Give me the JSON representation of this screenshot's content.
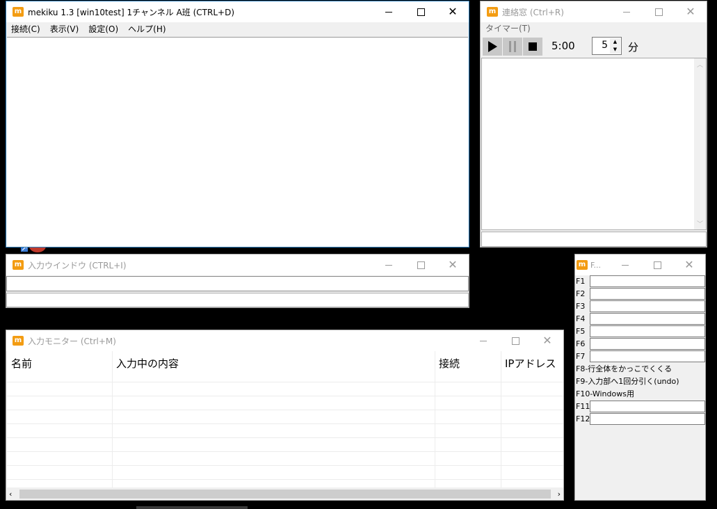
{
  "main_window": {
    "title": "mekiku 1.3 [win10test] 1チャンネル A班 (CTRL+D)",
    "menu": [
      "接続(C)",
      "表示(V)",
      "設定(O)",
      "ヘルプ(H)"
    ]
  },
  "contact_window": {
    "title": "連絡窓 (Ctrl+R)",
    "menu": [
      "タイマー(T)"
    ],
    "timer_display": "5:00",
    "minutes_value": "5",
    "minutes_unit": "分"
  },
  "input_window": {
    "title": "入力ウインドウ (CTRL+I)"
  },
  "monitor_window": {
    "title": "入力モニター (Ctrl+M)",
    "columns": [
      "名前",
      "入力中の内容",
      "接続",
      "IPアドレス"
    ]
  },
  "fkey_window": {
    "title": "F...",
    "keys_top": [
      "F1",
      "F2",
      "F3",
      "F4",
      "F5",
      "F6",
      "F7"
    ],
    "notes": [
      "F8-行全体をかっこでくくる",
      "F9-入力部へ1回分引く(undo)",
      "F10-Windows用"
    ],
    "keys_bottom": [
      "F11",
      "F12"
    ]
  },
  "colors": {
    "app_icon": "#f39c12",
    "active_border": "#2b7bb9"
  },
  "icons": {
    "app": "mekiku-app-icon",
    "minimize": "minimize-icon",
    "maximize": "maximize-icon",
    "close": "close-icon",
    "play": "play-icon",
    "pause": "pause-icon",
    "stop": "stop-icon"
  }
}
